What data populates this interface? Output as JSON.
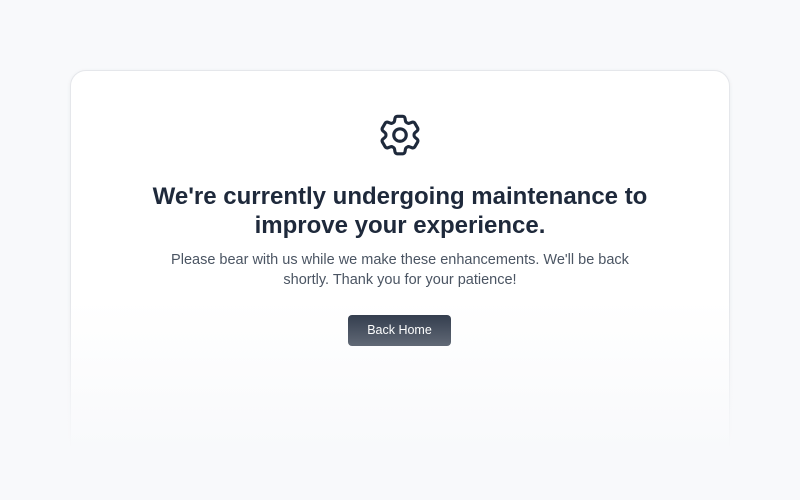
{
  "maintenance": {
    "icon": "gear-icon",
    "title": "We're currently undergoing maintenance to improve your experience.",
    "message": "Please bear with us while we make these enhancements. We'll be back shortly. Thank you for your patience!",
    "button_label": "Back Home"
  },
  "colors": {
    "background": "#f8f9fb",
    "card": "#ffffff",
    "heading": "#1e293b",
    "body_text": "#4b5563",
    "button_bg": "#1e293b",
    "button_text": "#ffffff"
  }
}
